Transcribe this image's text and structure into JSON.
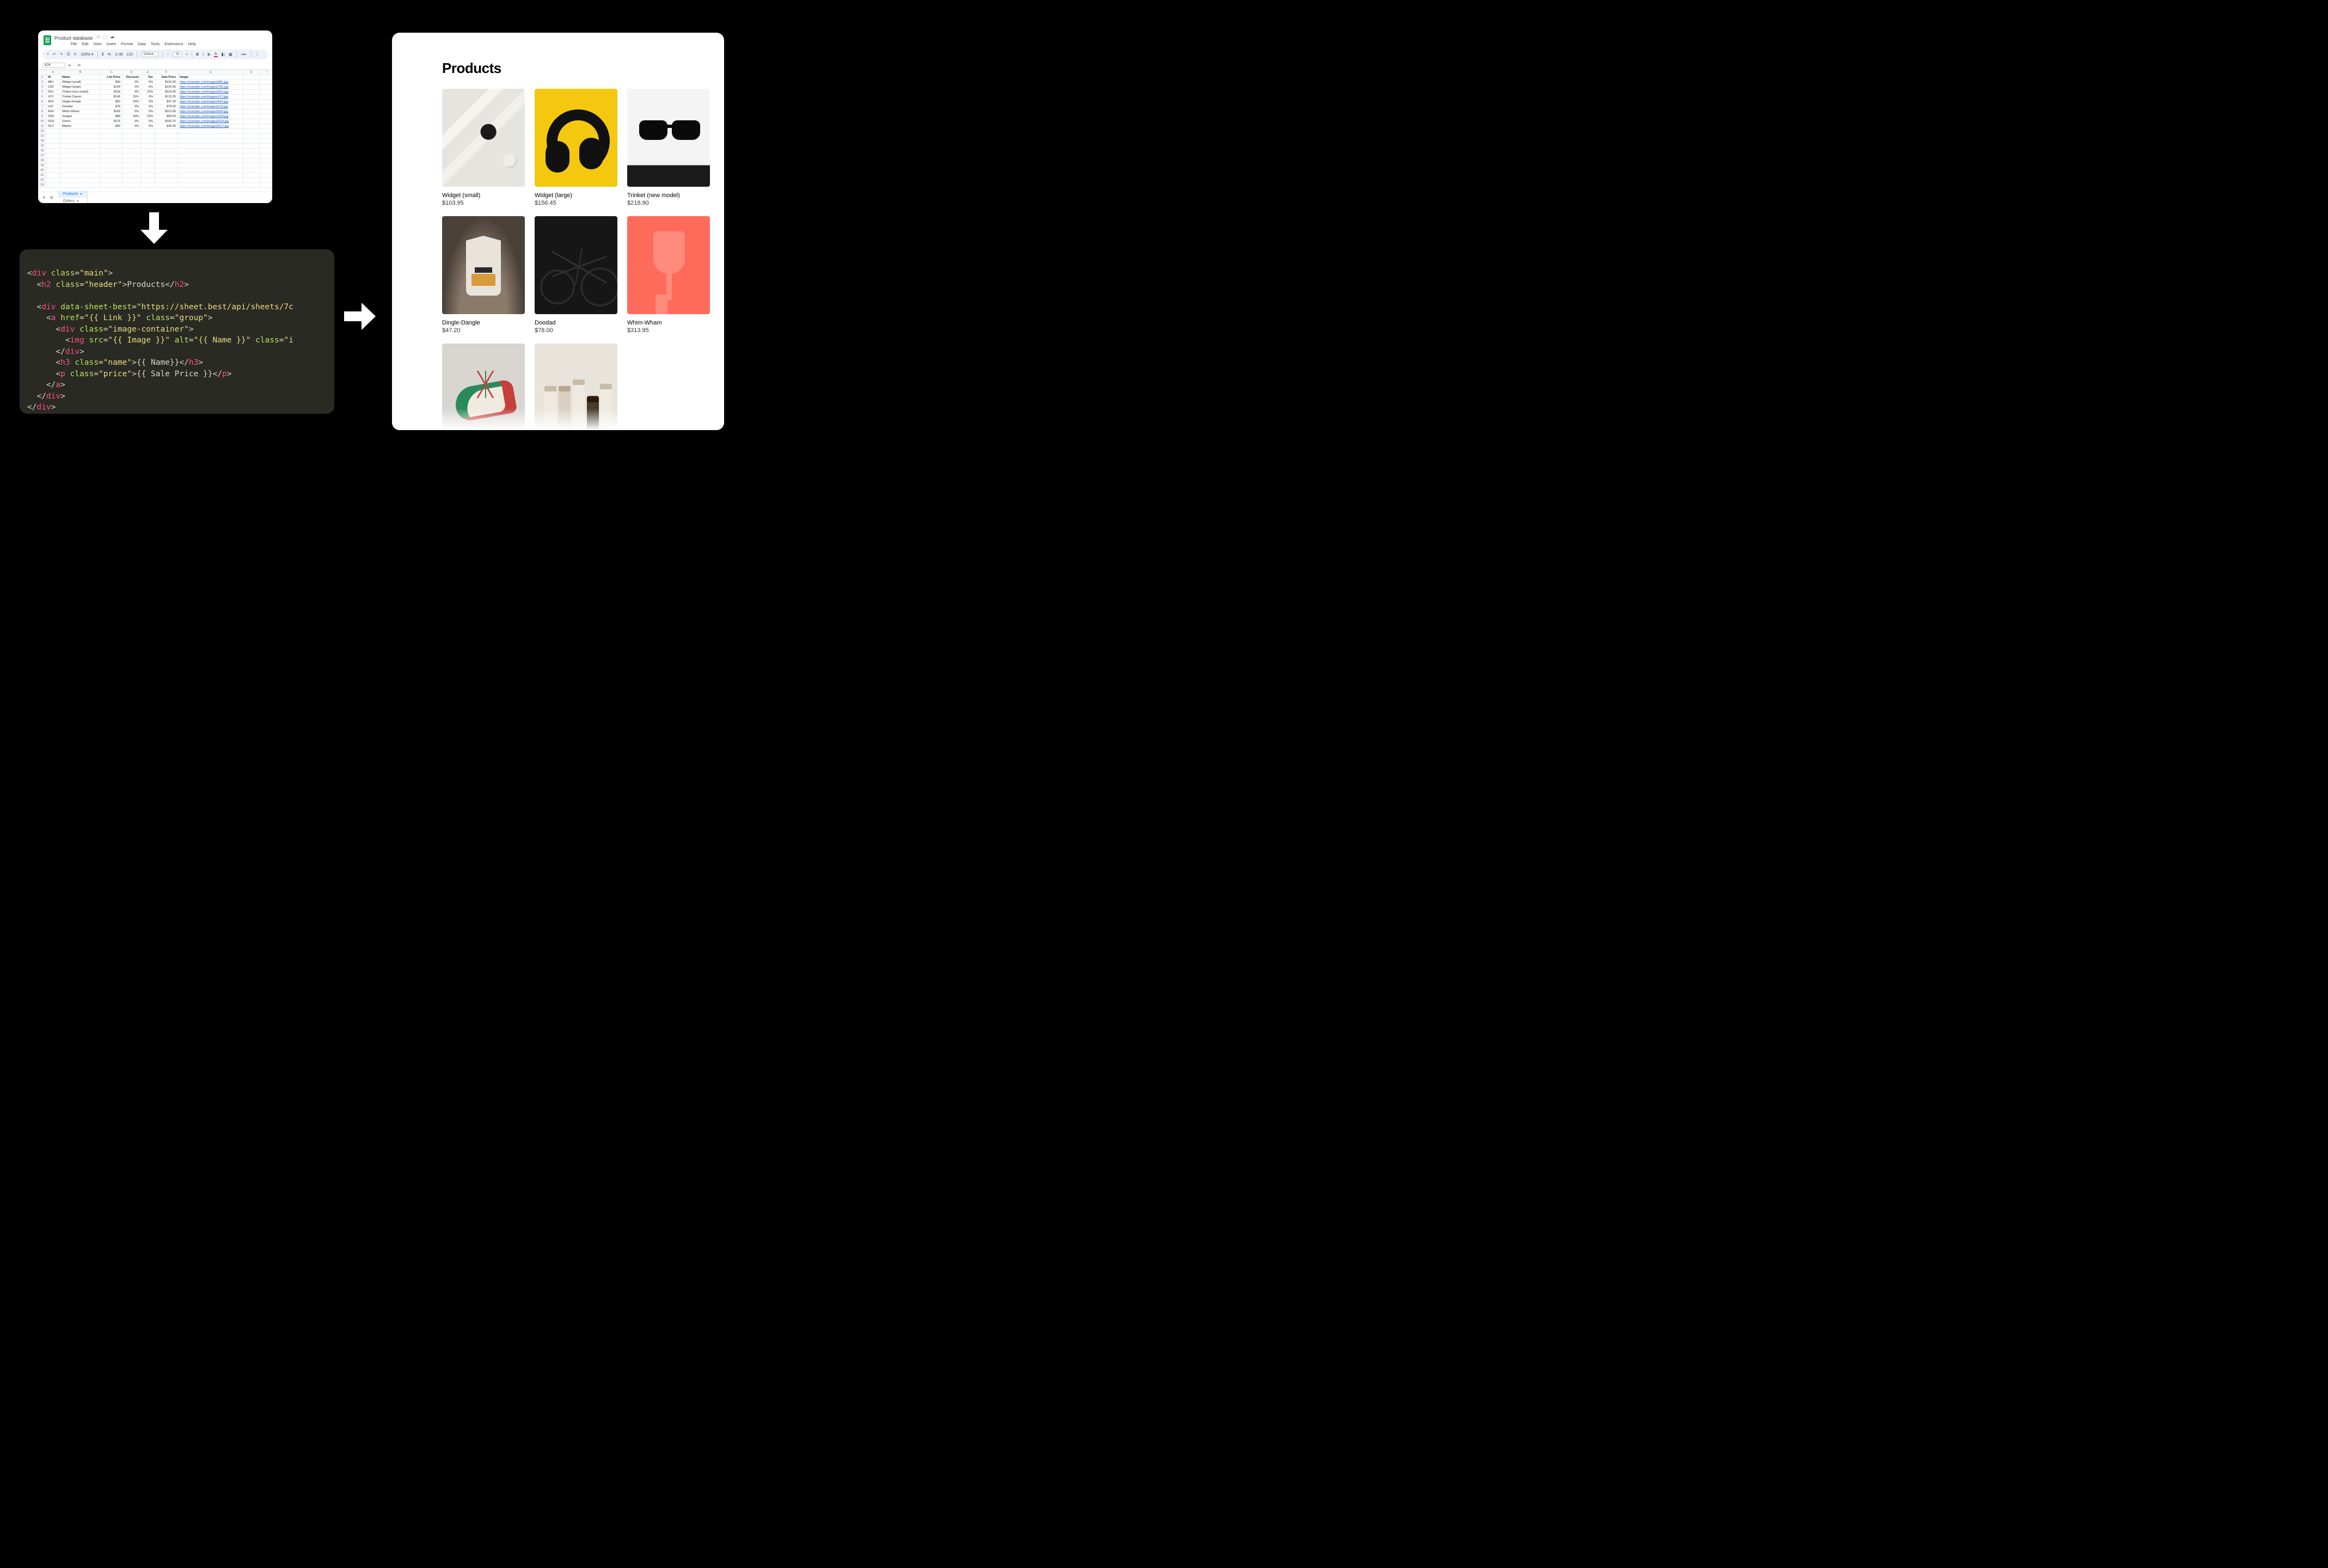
{
  "sheets": {
    "doc_title": "Product database",
    "title_icons": [
      "☆",
      "🗀",
      "☁"
    ],
    "menus": [
      "File",
      "Edit",
      "View",
      "Insert",
      "Format",
      "Data",
      "Tools",
      "Extensions",
      "Help"
    ],
    "toolbar": {
      "zoom": "100%",
      "font": "Defaul...",
      "fontsize": "10",
      "currency": "$",
      "percent": "%",
      "decimals": ".0 .00",
      "digits": "123"
    },
    "namebox": "K24",
    "fx": "fx",
    "column_letters": [
      "",
      "A",
      "B",
      "C",
      "D",
      "E",
      "F",
      "G",
      "H",
      "I"
    ],
    "headers": [
      "ID",
      "Name",
      "List Price",
      "Discount",
      "Tax",
      "Sale Price",
      "Image"
    ],
    "rows": [
      {
        "n": "2",
        "id": "AB1",
        "name": "Widget (small)",
        "list": "$99",
        "disc": "0%",
        "tax": "5%",
        "sale": "$103.95",
        "link": "https://example.com/images/AB1.jpg"
      },
      {
        "n": "3",
        "id": "CB2",
        "name": "Widget (large)",
        "list": "$149",
        "disc": "0%",
        "tax": "5%",
        "sale": "$156.45",
        "link": "https://example.com/images/CB2.jpg"
      },
      {
        "n": "4",
        "id": "DE1",
        "name": "Trinket (new model)",
        "list": "$199",
        "disc": "0%",
        "tax": "10%",
        "sale": "$218.90",
        "link": "https://example.com/images/DE1.jpg"
      },
      {
        "n": "5",
        "id": "XY2",
        "name": "Trinket Classic",
        "list": "$145",
        "disc": "15%",
        "tax": "0%",
        "sale": "$123.25",
        "link": "https://example.com/images/XY2.jpg"
      },
      {
        "n": "6",
        "id": "AZ4",
        "name": "Dingle-Dangle",
        "list": "$59",
        "disc": "20%",
        "tax": "0%",
        "sale": "$47.20",
        "link": "https://example.com/images/AZ4.jpg"
      },
      {
        "n": "7",
        "id": "HJ2",
        "name": "Doodad",
        "list": "$78",
        "disc": "0%",
        "tax": "0%",
        "sale": "$78.00",
        "link": "https://example.com/images/HJ2.jpg"
      },
      {
        "n": "8",
        "id": "AS4",
        "name": "Whim-Wham",
        "list": "$299",
        "disc": "0%",
        "tax": "5%",
        "sale": "$313.95",
        "link": "https://example.com/images/AS4.jpg"
      },
      {
        "n": "9",
        "id": "SD8",
        "name": "Gadget",
        "list": "$89",
        "disc": "30%",
        "tax": "10%",
        "sale": "$68.53",
        "link": "https://example.com/images/SD8.jpg"
      },
      {
        "n": "10",
        "id": "DG4",
        "name": "Gismo",
        "list": "$175",
        "disc": "0%",
        "tax": "5%",
        "sale": "$183.75",
        "link": "https://example.com/images/DG4.jpg"
      },
      {
        "n": "11",
        "id": "DU7",
        "name": "Bibelot",
        "list": "$49",
        "disc": "0%",
        "tax": "0%",
        "sale": "$49.00",
        "link": "https://example.com/images/DU7.jpg"
      }
    ],
    "empty_row_numbers": [
      "12",
      "13",
      "14",
      "15",
      "16",
      "17",
      "18",
      "19",
      "20",
      "21",
      "22",
      "23"
    ],
    "tabs": {
      "add": "+",
      "all": "≡",
      "items": [
        {
          "label": "Products",
          "active": true
        },
        {
          "label": "Orders",
          "active": false
        }
      ]
    }
  },
  "code": {
    "lines": [
      [
        [
          "punc",
          "<"
        ],
        [
          "tag",
          "div "
        ],
        [
          "attr",
          "class"
        ],
        [
          "punc",
          "="
        ],
        [
          "str",
          "\"main\""
        ],
        [
          "punc",
          ">"
        ]
      ],
      [
        [
          "punc",
          "  <"
        ],
        [
          "tag",
          "h2 "
        ],
        [
          "attr",
          "class"
        ],
        [
          "punc",
          "="
        ],
        [
          "str",
          "\"header\""
        ],
        [
          "punc",
          ">"
        ],
        [
          "text",
          "Products"
        ],
        [
          "punc",
          "</"
        ],
        [
          "tag",
          "h2"
        ],
        [
          "punc",
          ">"
        ]
      ],
      [
        [
          "text",
          ""
        ]
      ],
      [
        [
          "punc",
          "  <"
        ],
        [
          "tag",
          "div "
        ],
        [
          "attr",
          "data-sheet-best"
        ],
        [
          "punc",
          "="
        ],
        [
          "str",
          "\"https://sheet.best/api/sheets/7c"
        ]
      ],
      [
        [
          "punc",
          "    <"
        ],
        [
          "tag",
          "a "
        ],
        [
          "attr",
          "href"
        ],
        [
          "punc",
          "="
        ],
        [
          "str",
          "\"{{ Link }}\" "
        ],
        [
          "attr",
          "class"
        ],
        [
          "punc",
          "="
        ],
        [
          "str",
          "\"group\""
        ],
        [
          "punc",
          ">"
        ]
      ],
      [
        [
          "punc",
          "      <"
        ],
        [
          "tag",
          "div "
        ],
        [
          "attr",
          "class"
        ],
        [
          "punc",
          "="
        ],
        [
          "str",
          "\"image-container\""
        ],
        [
          "punc",
          ">"
        ]
      ],
      [
        [
          "punc",
          "        <"
        ],
        [
          "tag",
          "img "
        ],
        [
          "attr",
          "src"
        ],
        [
          "punc",
          "="
        ],
        [
          "str",
          "\"{{ Image }}\" "
        ],
        [
          "attr",
          "alt"
        ],
        [
          "punc",
          "="
        ],
        [
          "str",
          "\"{{ Name }}\" "
        ],
        [
          "attr",
          "class"
        ],
        [
          "punc",
          "="
        ],
        [
          "str",
          "\"i"
        ]
      ],
      [
        [
          "punc",
          "      </"
        ],
        [
          "tag",
          "div"
        ],
        [
          "punc",
          ">"
        ]
      ],
      [
        [
          "punc",
          "      <"
        ],
        [
          "tag",
          "h3 "
        ],
        [
          "attr",
          "class"
        ],
        [
          "punc",
          "="
        ],
        [
          "str",
          "\"name\""
        ],
        [
          "punc",
          ">"
        ],
        [
          "text",
          "{{ Name}}"
        ],
        [
          "punc",
          "</"
        ],
        [
          "tag",
          "h3"
        ],
        [
          "punc",
          ">"
        ]
      ],
      [
        [
          "punc",
          "      <"
        ],
        [
          "tag",
          "p "
        ],
        [
          "attr",
          "class"
        ],
        [
          "punc",
          "="
        ],
        [
          "str",
          "\"price\""
        ],
        [
          "punc",
          ">"
        ],
        [
          "text",
          "{{ Sale Price }}"
        ],
        [
          "punc",
          "</"
        ],
        [
          "tag",
          "p"
        ],
        [
          "punc",
          ">"
        ]
      ],
      [
        [
          "punc",
          "    </"
        ],
        [
          "tag",
          "a"
        ],
        [
          "punc",
          ">"
        ]
      ],
      [
        [
          "punc",
          "  </"
        ],
        [
          "tag",
          "div"
        ],
        [
          "punc",
          ">"
        ]
      ],
      [
        [
          "punc",
          "</"
        ],
        [
          "tag",
          "div"
        ],
        [
          "punc",
          ">"
        ]
      ]
    ]
  },
  "render": {
    "heading": "Products",
    "cards": [
      {
        "name": "Widget (small)",
        "price": "$103.95",
        "thumb": "watch"
      },
      {
        "name": "Widget (large)",
        "price": "$156.45",
        "thumb": "headphones"
      },
      {
        "name": "Trinket (new model)",
        "price": "$218.90",
        "thumb": "sunglasses"
      },
      {
        "name": "Dingle-Dangle",
        "price": "$47.20",
        "thumb": "coffee"
      },
      {
        "name": "Doodad",
        "price": "$78.00",
        "thumb": "bike"
      },
      {
        "name": "Whim-Wham",
        "price": "$313.95",
        "thumb": "cup"
      },
      {
        "name": "",
        "price": "",
        "thumb": "shoe"
      },
      {
        "name": "",
        "price": "",
        "thumb": "bottles"
      }
    ]
  }
}
